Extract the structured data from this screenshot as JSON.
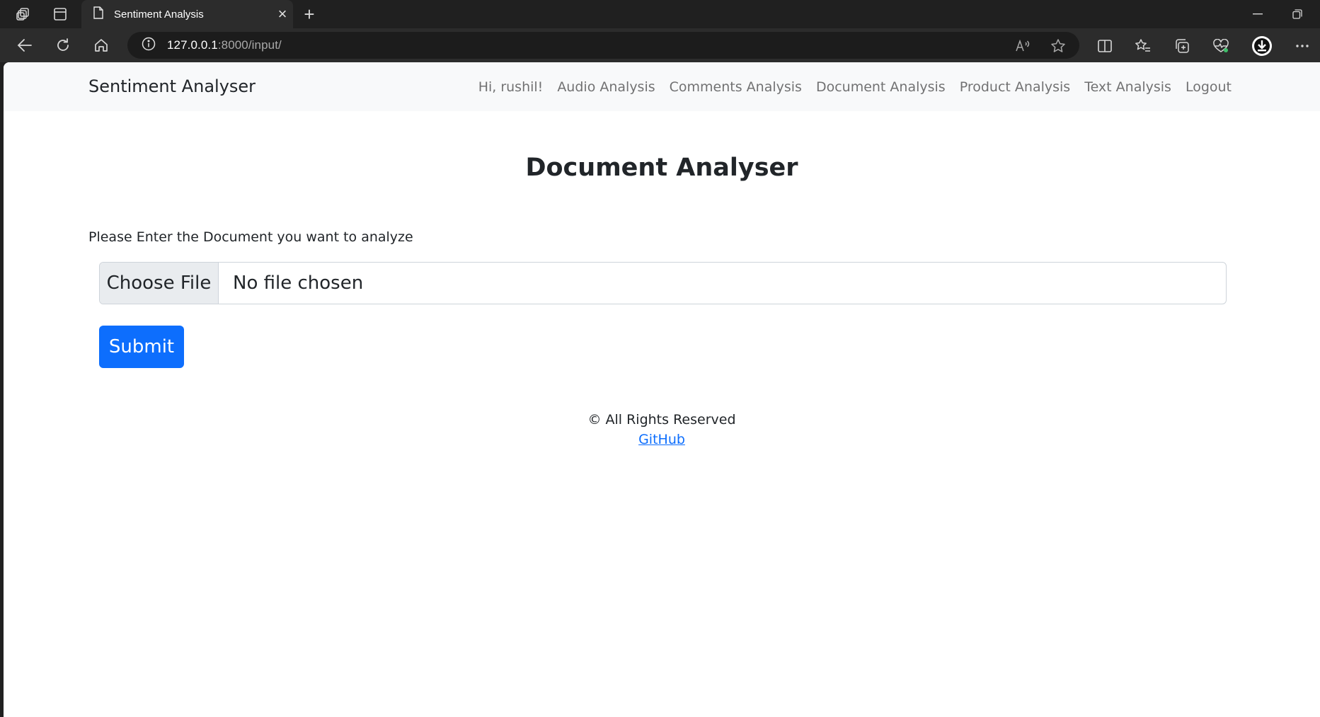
{
  "browser": {
    "tab_title": "Sentiment Analysis",
    "url_host": "127.0.0.1",
    "url_rest": ":8000/input/",
    "newtab_symbol": "+",
    "close_symbol": "×"
  },
  "navbar": {
    "brand": "Sentiment Analyser",
    "links": [
      {
        "label": "Hi, rushil!"
      },
      {
        "label": "Audio Analysis"
      },
      {
        "label": "Comments Analysis"
      },
      {
        "label": "Document Analysis"
      },
      {
        "label": "Product Analysis"
      },
      {
        "label": "Text Analysis"
      },
      {
        "label": "Logout"
      }
    ]
  },
  "main": {
    "title": "Document Analyser",
    "prompt": "Please Enter the Document you want to analyze",
    "file_button": "Choose File",
    "file_status": "No file chosen",
    "submit": "Submit"
  },
  "footer": {
    "rights": "© All Rights Reserved",
    "link": "GitHub"
  },
  "colors": {
    "primary": "#0d6efd",
    "navbar_bg": "#f8f9fa",
    "chrome_bg": "#202020"
  }
}
